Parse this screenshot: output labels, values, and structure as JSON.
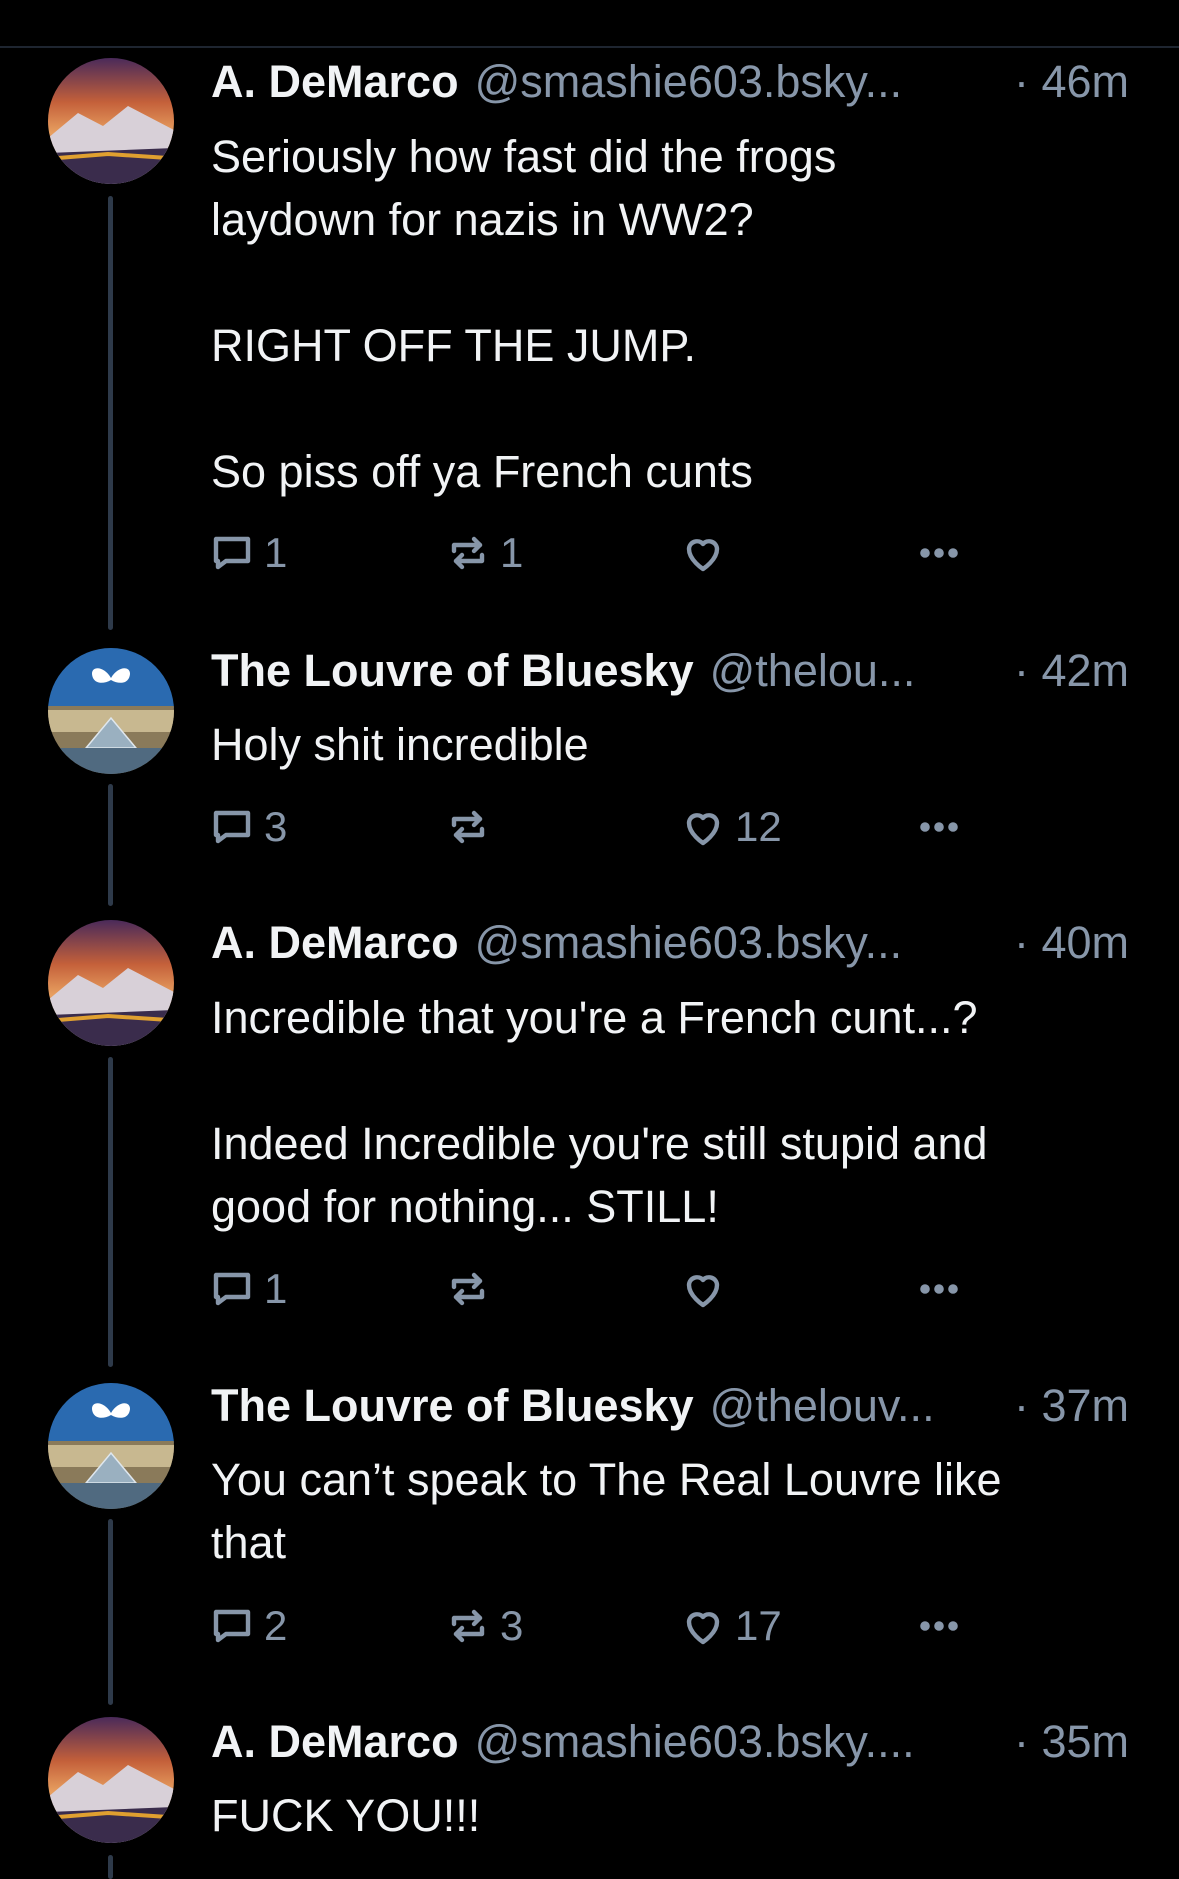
{
  "posts": [
    {
      "author": "A. DeMarco",
      "handle": "@smashie603.bsky...",
      "time": "· 46m",
      "text": "Seriously how fast did the frogs\nlaydown for nazis in WW2?\n\nRIGHT OFF THE JUMP.\n\nSo piss off ya French cunts",
      "replies": "1",
      "reposts": "1",
      "likes": "",
      "avatar": "sunset-mountain"
    },
    {
      "author": "The Louvre of Bluesky",
      "handle": "@thelou...",
      "time": "· 42m",
      "text": "Holy shit incredible",
      "replies": "3",
      "reposts": "",
      "likes": "12",
      "avatar": "louvre-butterfly"
    },
    {
      "author": "A. DeMarco",
      "handle": "@smashie603.bsky...",
      "time": "· 40m",
      "text": "Incredible that you're a French cunt...?\n\nIndeed Incredible you're still stupid and\ngood for nothing... STILL!",
      "replies": "1",
      "reposts": "",
      "likes": "",
      "avatar": "sunset-mountain"
    },
    {
      "author": "The Louvre of Bluesky",
      "handle": "@thelouv...",
      "time": "· 37m",
      "text": "You can’t speak to The Real Louvre like\nthat",
      "replies": "2",
      "reposts": "3",
      "likes": "17",
      "avatar": "louvre-butterfly"
    },
    {
      "author": "A. DeMarco",
      "handle": "@smashie603.bsky....",
      "time": "· 35m",
      "text": "FUCK YOU!!!",
      "replies": "",
      "reposts": "",
      "likes": "",
      "avatar": "sunset-mountain"
    }
  ],
  "colors": {
    "background": "#000000",
    "text": "#f1f3f5",
    "muted": "#8796a9",
    "thread_line": "#2e3a4a",
    "butterfly": "#ffffff"
  },
  "icons": {
    "reply": "reply-bubble-icon",
    "repost": "repost-arrows-icon",
    "like": "heart-icon",
    "more": "more-dots-icon"
  }
}
